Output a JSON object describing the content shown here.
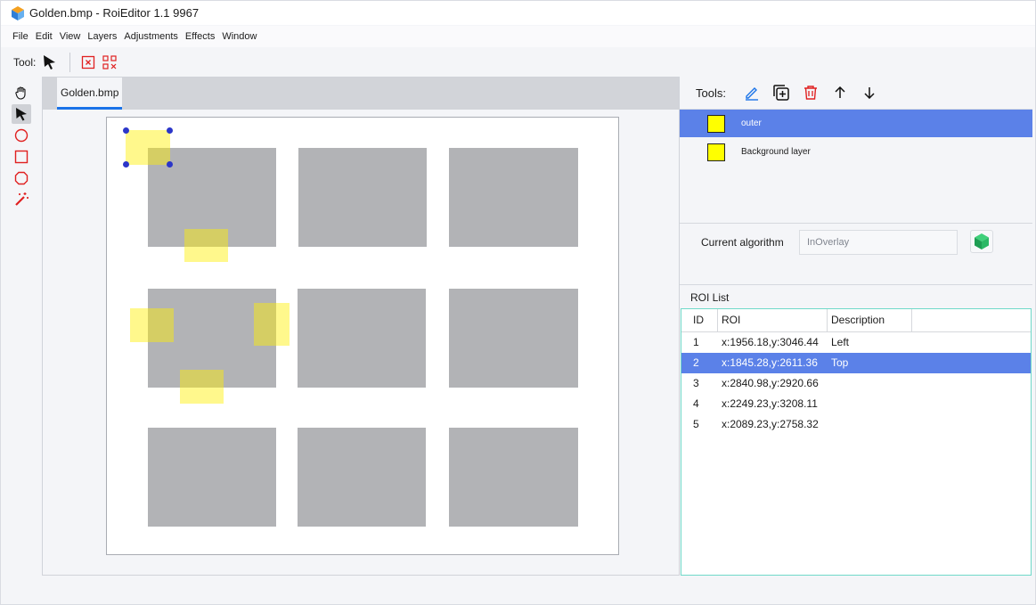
{
  "window": {
    "title": "Golden.bmp - RoiEditor 1.1 9967"
  },
  "menu": [
    "File",
    "Edit",
    "View",
    "Layers",
    "Adjustments",
    "Effects",
    "Window"
  ],
  "toolbar": {
    "tool_label": "Tool:",
    "icons": [
      "cursor-icon",
      "delete-roi-icon",
      "delete-all-rois-icon"
    ]
  },
  "left_tools": [
    "hand-icon",
    "pointer-icon",
    "ellipse-icon",
    "rectangle-icon",
    "polygon-icon",
    "magic-wand-icon"
  ],
  "document": {
    "tab": "Golden.bmp"
  },
  "panel": {
    "tools_label": "Tools:",
    "tool_icons": [
      "edit-icon",
      "duplicate-icon",
      "delete-icon",
      "move-up-icon",
      "move-down-icon"
    ],
    "layers": [
      {
        "name": "outer",
        "color": "#ffff00",
        "selected": true
      },
      {
        "name": "Background layer",
        "color": "#ffff00",
        "selected": false
      }
    ],
    "algorithm_label": "Current algorithm",
    "algorithm_value": "InOverlay",
    "roi_list_title": "ROI List",
    "roi_columns": [
      "ID",
      "ROI",
      "Description"
    ],
    "roi_rows": [
      {
        "id": "1",
        "roi": "x:1956.18,y:3046.44",
        "desc": "Left",
        "selected": false
      },
      {
        "id": "2",
        "roi": "x:1845.28,y:2611.36",
        "desc": "Top",
        "selected": true
      },
      {
        "id": "3",
        "roi": "x:2840.98,y:2920.66",
        "desc": "",
        "selected": false
      },
      {
        "id": "4",
        "roi": "x:2249.23,y:3208.11",
        "desc": "",
        "selected": false
      },
      {
        "id": "5",
        "roi": "x:2089.23,y:2758.32",
        "desc": "",
        "selected": false
      }
    ]
  },
  "colors": {
    "selection": "#5b81e8",
    "accent_tab": "#1a73e8",
    "roi_fill": "#fff000",
    "delete_red": "#e02020"
  }
}
